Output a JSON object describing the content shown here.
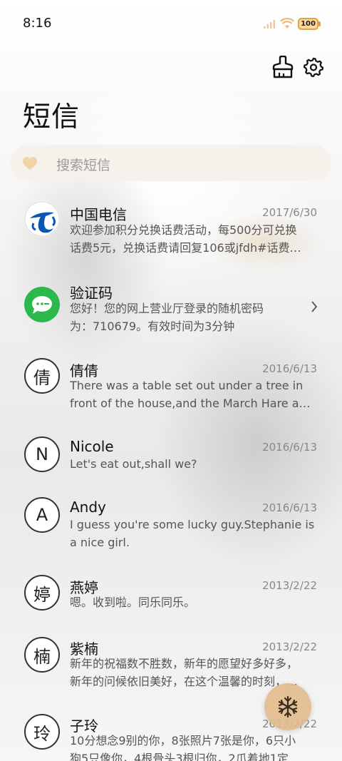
{
  "status_bar": {
    "time": "8:16",
    "battery": "100"
  },
  "header": {
    "title": "短信"
  },
  "search": {
    "placeholder": "搜索短信"
  },
  "messages": [
    {
      "name": "中国电信",
      "date": "2017/6/30",
      "line1": "欢迎参加积分兑换话费活动，每500分可兑换",
      "line2": "话费5元，兑换话费请回复106或jfdh#话费…",
      "avatar": "telecom-logo"
    },
    {
      "name": "验证码",
      "date": "",
      "line1": "您好！您的网上营业厅登录的随机密码",
      "line2": "为：710679。有效时间为3分钟",
      "avatar": "message-app-icon"
    },
    {
      "name": "倩倩",
      "date": "2016/6/13",
      "avatar_char": "倩",
      "line1": "There was a table set out under a tree in",
      "line2": "front of the house,and the March Hare an…"
    },
    {
      "name": "Nicole",
      "date": "2016/6/13",
      "avatar_char": "N",
      "line1": "Let's eat out,shall we?",
      "line2": ""
    },
    {
      "name": "Andy",
      "date": "2016/6/13",
      "avatar_char": "A",
      "line1": "I guess you're some lucky guy.Stephanie is",
      "line2": "a nice girl."
    },
    {
      "name": "燕婷",
      "date": "2013/2/22",
      "avatar_char": "婷",
      "line1": "嗯。收到啦。同乐同乐。",
      "line2": ""
    },
    {
      "name": "紫楠",
      "date": "2013/2/22",
      "avatar_char": "楠",
      "line1": "新年的祝福数不胜数，新年的愿望好多好多，",
      "line2": "新年的问候依旧美好，在这个温馨的时刻，…"
    },
    {
      "name": "子玲",
      "date": "2013/2/22",
      "avatar_char": "玲",
      "line1": "10分想念9别的你，8张照片7张是你，6只小",
      "line2": "狗5只像你，4根骨头3根归你，2爪着地1定"
    }
  ],
  "colors": {
    "accent": "#e2ba8c",
    "telecom_blue": "#0b57b4",
    "message_green": "#2db84b"
  },
  "icons": [
    "clean-brush-icon",
    "gear-icon",
    "search-heart-icon",
    "chevron-right-icon",
    "snowflake-icon"
  ]
}
